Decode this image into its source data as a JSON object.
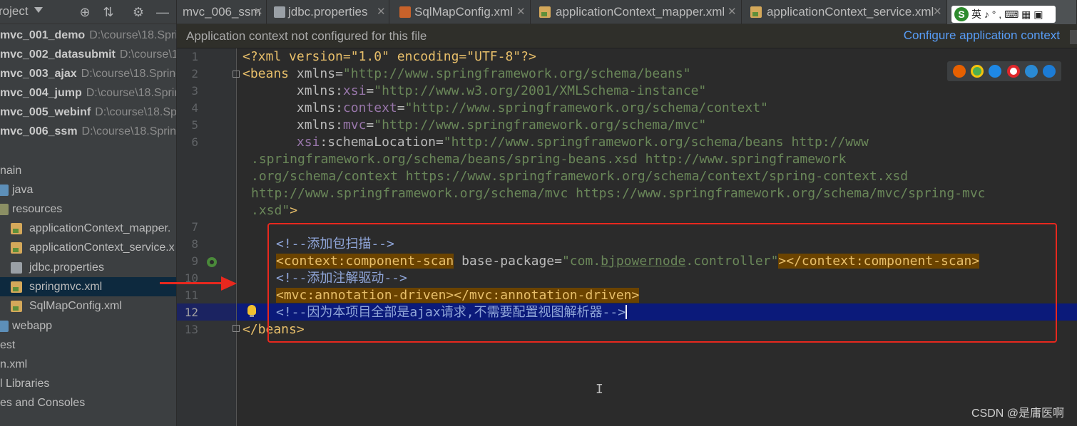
{
  "sidebar": {
    "title": "roject",
    "items": [
      {
        "name": "mvc_001_demo",
        "path": "D:\\course\\18.Spri"
      },
      {
        "name": "mvc_002_datasubmit",
        "path": "D:\\course\\1"
      },
      {
        "name": "mvc_003_ajax",
        "path": "D:\\course\\18.Spring"
      },
      {
        "name": "mvc_004_jump",
        "path": "D:\\course\\18.Sprir"
      },
      {
        "name": "mvc_005_webinf",
        "path": "D:\\course\\18.Spr"
      },
      {
        "name": "mvc_006_ssm",
        "path": "D:\\course\\18.Spring"
      }
    ],
    "tree": {
      "main": "nain",
      "java": "java",
      "resources": "resources",
      "file1": "applicationContext_mapper.",
      "file2": "applicationContext_service.x",
      "file3": "jdbc.properties",
      "file4": "springmvc.xml",
      "file5": "SqlMapConfig.xml",
      "webapp": "webapp",
      "test": "est",
      "pom": "n.xml",
      "libs": "l Libraries",
      "scratches": "es and Consoles"
    }
  },
  "tabs": [
    {
      "label": "mvc_006_ssm"
    },
    {
      "label": "jdbc.properties"
    },
    {
      "label": "SqlMapConfig.xml"
    },
    {
      "label": "applicationContext_mapper.xml"
    },
    {
      "label": "applicationContext_service.xml"
    }
  ],
  "ime": {
    "logo": "S",
    "text": "英 ♪ ° , ⌨ ▦ ▣"
  },
  "notification": {
    "text": "Application context not configured for this file",
    "link": "Configure application context"
  },
  "editor": {
    "line_numbers": [
      "1",
      "2",
      "3",
      "4",
      "5",
      "6",
      "7",
      "8",
      "9",
      "10",
      "11",
      "12",
      "13"
    ],
    "current_line": "12",
    "lines": {
      "l1": "<?xml version=\"1.0\" encoding=\"UTF-8\"?>",
      "l2_tag": "<beans",
      "l2_attr": "xmlns",
      "l2_val": "\"http://www.springframework.org/schema/beans\"",
      "l3_ns": "xmlns:",
      "l3_attr": "xsi",
      "l3_val": "\"http://www.w3.org/2001/XMLSchema-instance\"",
      "l4_ns": "xmlns:",
      "l4_attr": "context",
      "l4_val": "\"http://www.springframework.org/schema/context\"",
      "l5_ns": "xmlns:",
      "l5_attr": "mvc",
      "l5_val": "\"http://www.springframework.org/schema/mvc\"",
      "l6_ns": "xsi",
      "l6_attr": ":schemaLocation",
      "l6_val1": "\"http://www.springframework.org/schema/beans http://www",
      "l6_val2": ".springframework.org/schema/beans/spring-beans.xsd http://www.springframework",
      "l6_val3": ".org/schema/context https://www.springframework.org/schema/context/spring-context.xsd",
      "l6_val4": "http://www.springframework.org/schema/mvc https://www.springframework.org/schema/mvc/spring-mvc",
      "l6_val5": ".xsd\"",
      "l6_end": ">",
      "l8": "<!--添加包扫描-->",
      "l9_open": "<context:component-scan",
      "l9_attr": " base-package=",
      "l9_val_a": "\"com.",
      "l9_val_b": "bjpowernode",
      "l9_val_c": ".controller\"",
      "l9_close": "></context:component-scan>",
      "l10": "<!--添加注解驱动-->",
      "l11": "<mvc:annotation-driven></mvc:annotation-driven>",
      "l12": "<!--因为本项目全部是ajax请求,不需要配置视图解析器-->",
      "l13": "</beans>"
    }
  },
  "browser_icons": [
    "firefox-icon",
    "chrome-icon",
    "safari-icon",
    "opera-icon",
    "ie-icon",
    "edge-icon"
  ],
  "text_cursor": "I",
  "watermark": "CSDN @是庸医啊",
  "colors": {
    "accent_link": "#589df6",
    "annotation_red": "#e8281e",
    "current_line": "#0b1a7a",
    "selected_tree": "#0d293e"
  }
}
